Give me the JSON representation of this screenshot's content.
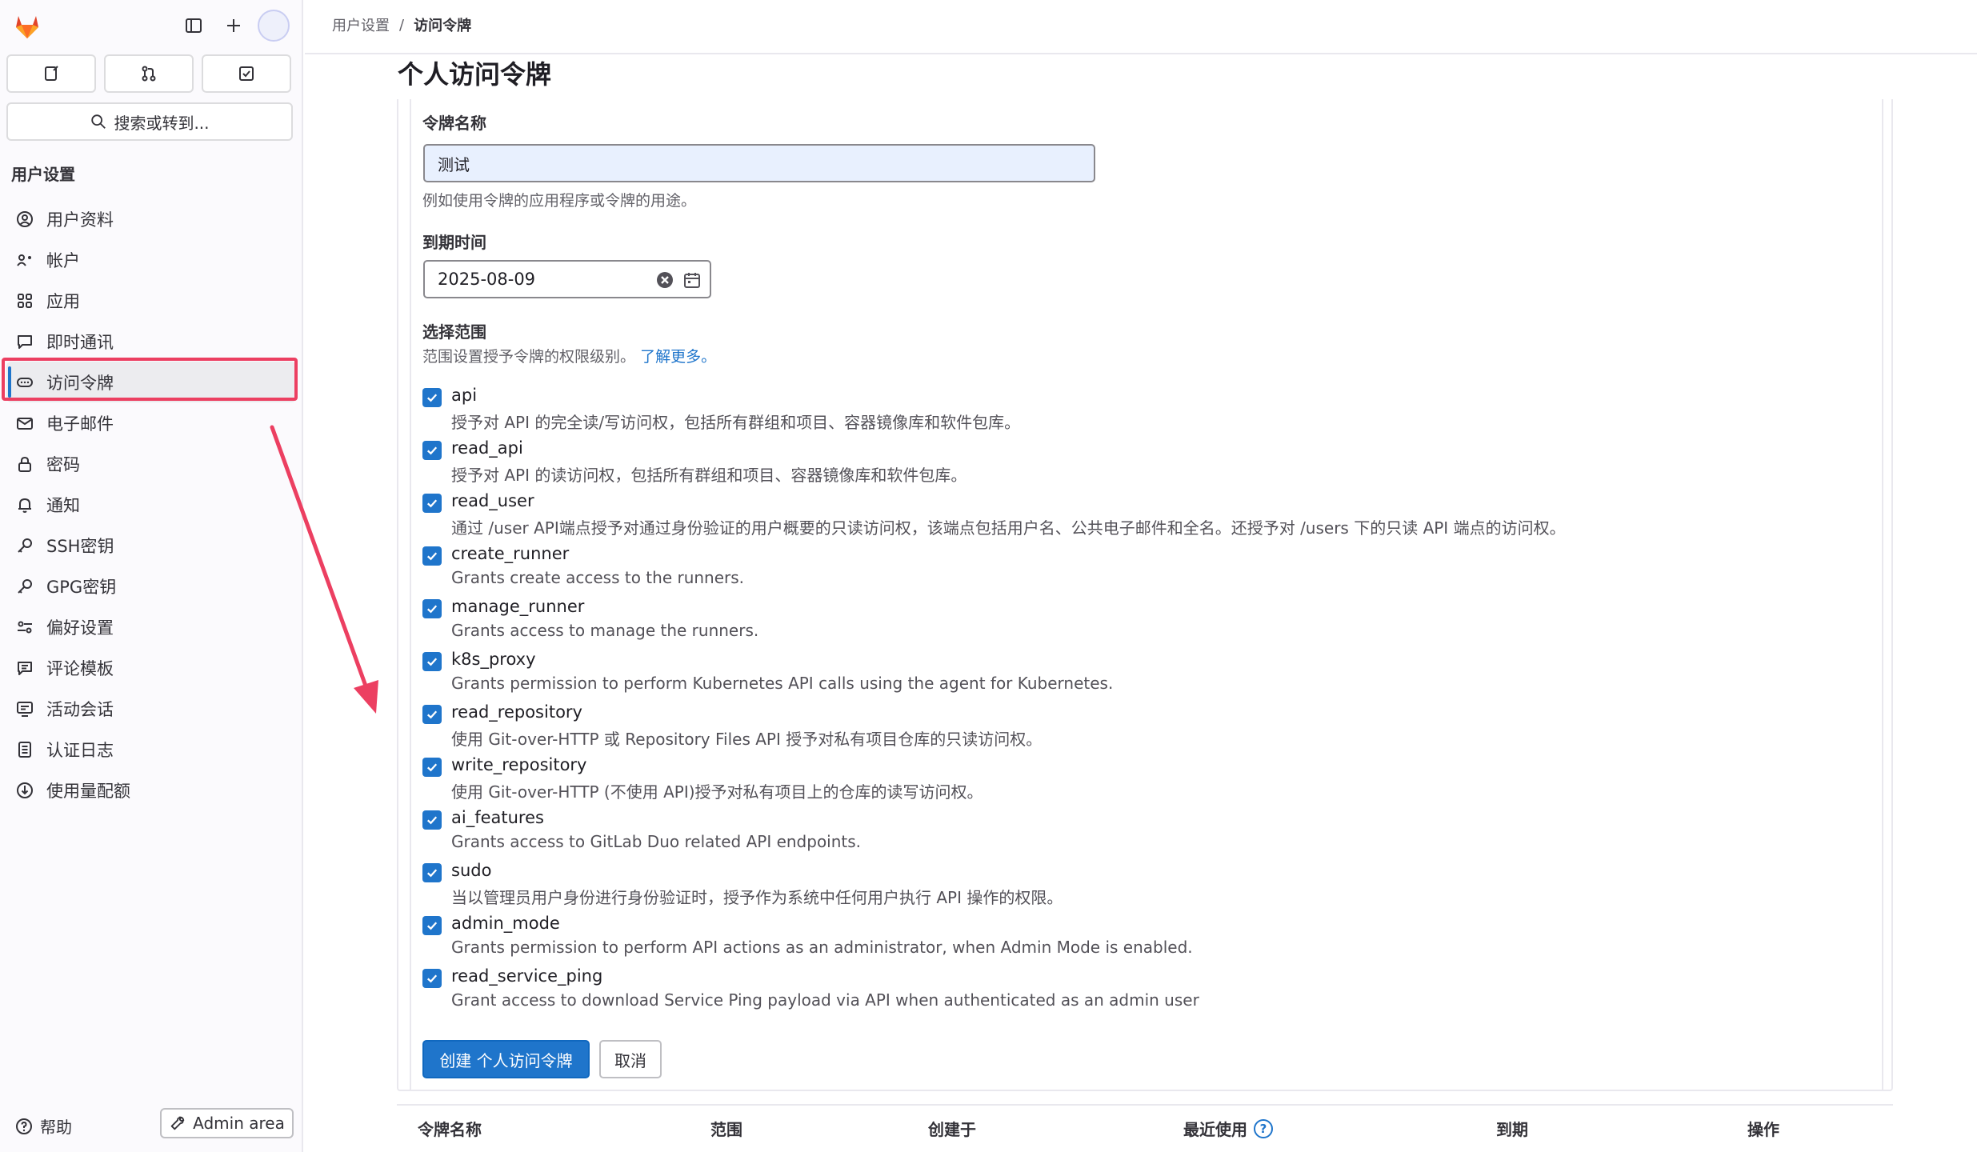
{
  "breadcrumb": {
    "parent": "用户设置",
    "separator": "/",
    "current": "访问令牌"
  },
  "sidebar": {
    "search_label": "搜索或转到...",
    "section_title": "用户设置",
    "items": [
      {
        "label": "用户资料",
        "icon": "profile-icon"
      },
      {
        "label": "帐户",
        "icon": "account-icon"
      },
      {
        "label": "应用",
        "icon": "applications-icon"
      },
      {
        "label": "即时通讯",
        "icon": "chat-icon"
      },
      {
        "label": "访问令牌",
        "icon": "token-icon",
        "active": true
      },
      {
        "label": "电子邮件",
        "icon": "mail-icon"
      },
      {
        "label": "密码",
        "icon": "lock-icon"
      },
      {
        "label": "通知",
        "icon": "bell-icon"
      },
      {
        "label": "SSH密钥",
        "icon": "key-icon"
      },
      {
        "label": "GPG密钥",
        "icon": "key-icon"
      },
      {
        "label": "偏好设置",
        "icon": "preferences-icon"
      },
      {
        "label": "评论模板",
        "icon": "comment-template-icon"
      },
      {
        "label": "活动会话",
        "icon": "monitor-icon"
      },
      {
        "label": "认证日志",
        "icon": "log-icon"
      },
      {
        "label": "使用量配额",
        "icon": "quota-icon"
      }
    ],
    "help_label": "帮助",
    "admin_label": "Admin area"
  },
  "page": {
    "title": "个人访问令牌"
  },
  "form": {
    "name_label": "令牌名称",
    "name_value": "测试",
    "name_help": "例如使用令牌的应用程序或令牌的用途。",
    "expiry_label": "到期时间",
    "expiry_value": "2025-08-09",
    "scope_label": "选择范围",
    "scope_help": "范围设置授予令牌的权限级别。",
    "learn_more": "了解更多。",
    "scopes": [
      {
        "name": "api",
        "desc": "授予对 API 的完全读/写访问权，包括所有群组和项目、容器镜像库和软件包库。",
        "checked": true
      },
      {
        "name": "read_api",
        "desc": "授予对 API 的读访问权，包括所有群组和项目、容器镜像库和软件包库。",
        "checked": true
      },
      {
        "name": "read_user",
        "desc": "通过 /user API端点授予对通过身份验证的用户概要的只读访问权，该端点包括用户名、公共电子邮件和全名。还授予对 /users 下的只读 API 端点的访问权。",
        "checked": true
      },
      {
        "name": "create_runner",
        "desc": "Grants create access to the runners.",
        "checked": true
      },
      {
        "name": "manage_runner",
        "desc": "Grants access to manage the runners.",
        "checked": true
      },
      {
        "name": "k8s_proxy",
        "desc": "Grants permission to perform Kubernetes API calls using the agent for Kubernetes.",
        "checked": true
      },
      {
        "name": "read_repository",
        "desc": "使用 Git-over-HTTP 或 Repository Files API 授予对私有项目仓库的只读访问权。",
        "checked": true
      },
      {
        "name": "write_repository",
        "desc": "使用 Git-over-HTTP (不使用 API)授予对私有项目上的仓库的读写访问权。",
        "checked": true
      },
      {
        "name": "ai_features",
        "desc": "Grants access to GitLab Duo related API endpoints.",
        "checked": true
      },
      {
        "name": "sudo",
        "desc": "当以管理员用户身份进行身份验证时，授予作为系统中任何用户执行 API 操作的权限。",
        "checked": true
      },
      {
        "name": "admin_mode",
        "desc": "Grants permission to perform API actions as an administrator, when Admin Mode is enabled.",
        "checked": true
      },
      {
        "name": "read_service_ping",
        "desc": "Grant access to download Service Ping payload via API when authenticated as an admin user",
        "checked": true
      }
    ],
    "create_button": "创建 个人访问令牌",
    "cancel_button": "取消"
  },
  "table": {
    "headers": [
      "令牌名称",
      "范围",
      "创建于",
      "最近使用",
      "到期",
      "操作"
    ]
  },
  "colors": {
    "accent": "#1f75cb",
    "highlight": "#ec3f61"
  }
}
